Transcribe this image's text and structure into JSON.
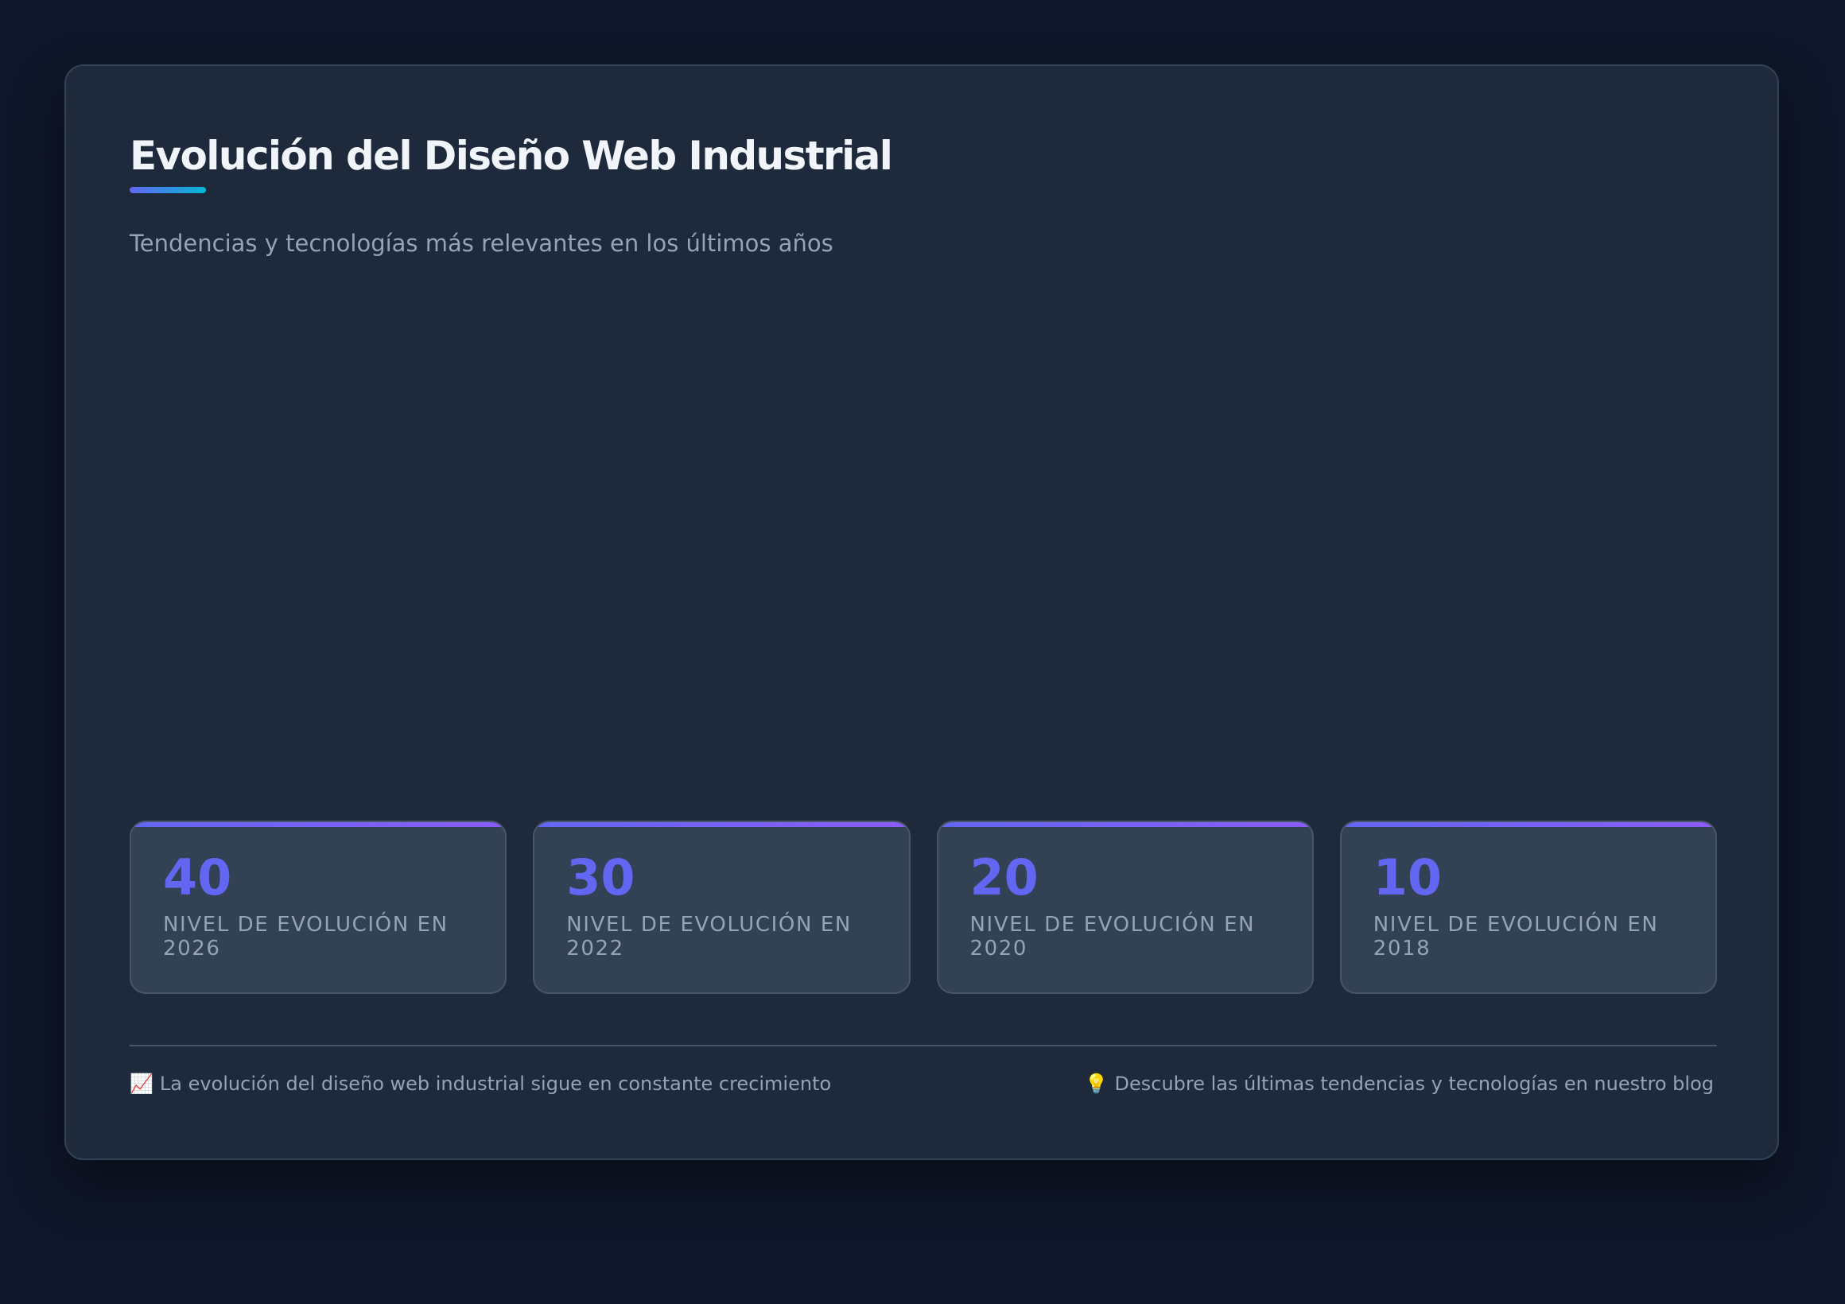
{
  "header": {
    "title": "Evolución del Diseño Web Industrial",
    "subtitle": "Tendencias y tecnologías más relevantes en los últimos años"
  },
  "stats": [
    {
      "value": "40",
      "label": "Nivel de evolución en 2026"
    },
    {
      "value": "30",
      "label": "Nivel de evolución en 2022"
    },
    {
      "value": "20",
      "label": "Nivel de evolución en 2020"
    },
    {
      "value": "10",
      "label": "Nivel de evolución en 2018"
    }
  ],
  "footer": {
    "left_icon": "📈",
    "left_text": "La evolución del diseño web industrial sigue en constante crecimiento",
    "right_icon": "💡",
    "right_text": "Descubre las últimas tendencias y tecnologías en nuestro blog"
  },
  "colors": {
    "background": "#0f172a",
    "card": "#1e293b",
    "accent": "#6366f1",
    "accent_secondary": "#06b6d4"
  }
}
